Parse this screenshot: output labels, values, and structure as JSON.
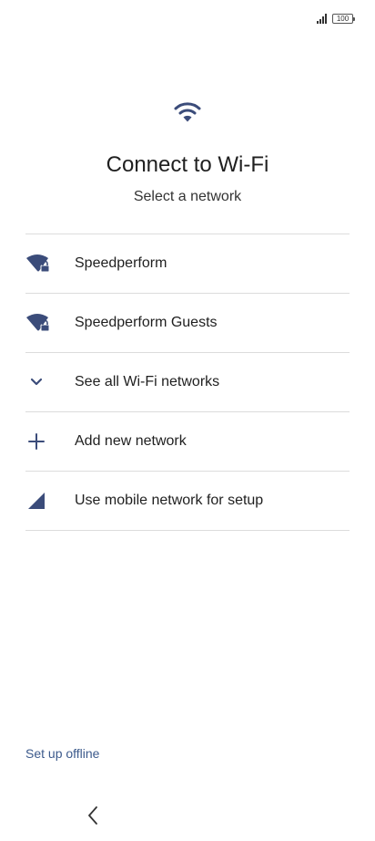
{
  "status_bar": {
    "battery_level": "100"
  },
  "header": {
    "icon": "wifi-icon",
    "title": "Connect to Wi-Fi",
    "subtitle": "Select a network"
  },
  "networks": [
    {
      "label": "Speedperform",
      "icon": "wifi-locked-icon"
    },
    {
      "label": "Speedperform Guests",
      "icon": "wifi-locked-icon"
    },
    {
      "label": "See all Wi-Fi networks",
      "icon": "chevron-down-icon"
    },
    {
      "label": "Add new network",
      "icon": "plus-icon"
    },
    {
      "label": "Use mobile network for setup",
      "icon": "mobile-signal-icon"
    }
  ],
  "footer": {
    "offline_link": "Set up offline",
    "back_icon": "back-chevron-icon"
  },
  "colors": {
    "accent": "#3c5a8c",
    "icon": "#3b4c7a",
    "divider": "#dcdcdc",
    "text": "#1f1f1f"
  }
}
